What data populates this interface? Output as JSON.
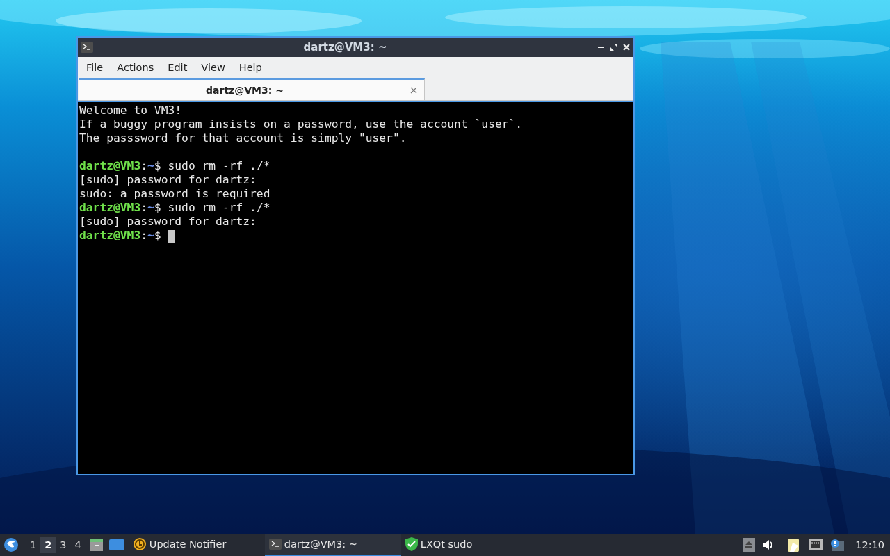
{
  "window": {
    "title": "dartz@VM3: ~"
  },
  "menu": [
    "File",
    "Actions",
    "Edit",
    "View",
    "Help"
  ],
  "tabs": [
    {
      "label": "dartz@VM3: ~",
      "selected": true
    }
  ],
  "terminal": {
    "lines": [
      {
        "kind": "text",
        "text": "Welcome to VM3!"
      },
      {
        "kind": "text",
        "text": "If a buggy program insists on a password, use the account `user`."
      },
      {
        "kind": "text",
        "text": "The passsword for that account is simply \"user\"."
      },
      {
        "kind": "blank"
      },
      {
        "kind": "prompt",
        "user": "dartz@VM3",
        "separator": ":",
        "path": "~",
        "symbol": "$",
        "command": "sudo rm -rf ./*",
        "cursor": false
      },
      {
        "kind": "text",
        "text": "[sudo] password for dartz:"
      },
      {
        "kind": "text",
        "text": "sudo: a password is required"
      },
      {
        "kind": "prompt",
        "user": "dartz@VM3",
        "separator": ":",
        "path": "~",
        "symbol": "$",
        "command": "sudo rm -rf ./*",
        "cursor": false
      },
      {
        "kind": "text",
        "text": "[sudo] password for dartz:"
      },
      {
        "kind": "prompt",
        "user": "dartz@VM3",
        "separator": ":",
        "path": "~",
        "symbol": "$",
        "cursor": true
      }
    ]
  },
  "taskbar": {
    "workspaces": [
      {
        "label": "1",
        "selected": false
      },
      {
        "label": "2",
        "selected": true
      },
      {
        "label": "3",
        "selected": false
      },
      {
        "label": "4",
        "selected": false
      }
    ],
    "tasks": [
      {
        "kind": "update",
        "label": "Update Notifier",
        "selected": false
      },
      {
        "kind": "terminal",
        "label": "dartz@VM3: ~",
        "selected": true
      },
      {
        "kind": "shield",
        "label": "LXQt sudo",
        "selected": false
      }
    ],
    "clock": "12:10"
  }
}
